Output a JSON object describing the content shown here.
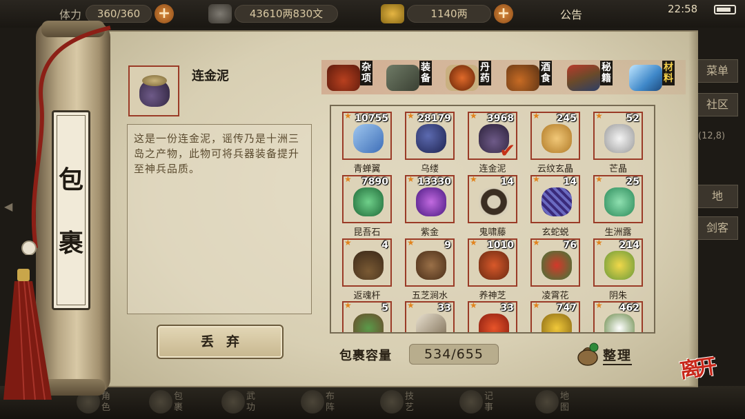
{
  "hud": {
    "stamina_label": "体力",
    "stamina_value": "360/360",
    "copper": "43610两830文",
    "gold": "1140两",
    "notice": "公告",
    "clock": "22:58"
  },
  "bag": {
    "title_chars": [
      "包",
      "裹"
    ],
    "selected": {
      "name": "连金泥",
      "description": "这是一份连金泥，谣传乃是十洲三岛之产物，此物可将兵器装备提升至神兵品质。"
    },
    "discard_label": "丢弃",
    "tabs": [
      {
        "label": "杂项",
        "icon": "sundries-jar-icon"
      },
      {
        "label": "装备",
        "icon": "equipment-scroll-icon"
      },
      {
        "label": "丹药",
        "icon": "pills-icon"
      },
      {
        "label": "酒食",
        "icon": "wine-food-icon"
      },
      {
        "label": "秘籍",
        "icon": "manual-books-icon"
      },
      {
        "label": "材料",
        "icon": "crystal-material-icon",
        "active": true
      }
    ],
    "items": [
      {
        "name": "青蝉翼",
        "count": "10755"
      },
      {
        "name": "乌缕",
        "count": "28179"
      },
      {
        "name": "连金泥",
        "count": "3968",
        "selected": true
      },
      {
        "name": "云纹玄晶",
        "count": "245"
      },
      {
        "name": "芒晶",
        "count": "52"
      },
      {
        "name": "昆吾石",
        "count": "7890"
      },
      {
        "name": "紫金",
        "count": "13330"
      },
      {
        "name": "鬼啸藤",
        "count": "14"
      },
      {
        "name": "玄蛇蜕",
        "count": "14"
      },
      {
        "name": "生洲露",
        "count": "25"
      },
      {
        "name": "返魂杆",
        "count": "4"
      },
      {
        "name": "五芝涧水",
        "count": "9"
      },
      {
        "name": "养神芝",
        "count": "1010"
      },
      {
        "name": "凌霄花",
        "count": "76"
      },
      {
        "name": "阴朱",
        "count": "214"
      },
      {
        "name": "",
        "count": "5"
      },
      {
        "name": "",
        "count": "33"
      },
      {
        "name": "",
        "count": "33"
      },
      {
        "name": "",
        "count": "747"
      },
      {
        "name": "",
        "count": "462"
      }
    ],
    "capacity_label": "包裹容量",
    "capacity_value": "534/655",
    "sort_label": "整理",
    "leave_label": "离开"
  },
  "side": {
    "menu": "菜单",
    "community": "社区",
    "coord": "(12,8)",
    "map_btn": "地",
    "hero_btn": "剑客"
  },
  "bottom_nav": [
    "角色",
    "包裹",
    "武功",
    "布阵",
    "技艺",
    "记事",
    "地图"
  ],
  "colors": {
    "slot_border": "#9a3a26",
    "active_tab": "#f5d14a",
    "leave": "#c8271a"
  }
}
